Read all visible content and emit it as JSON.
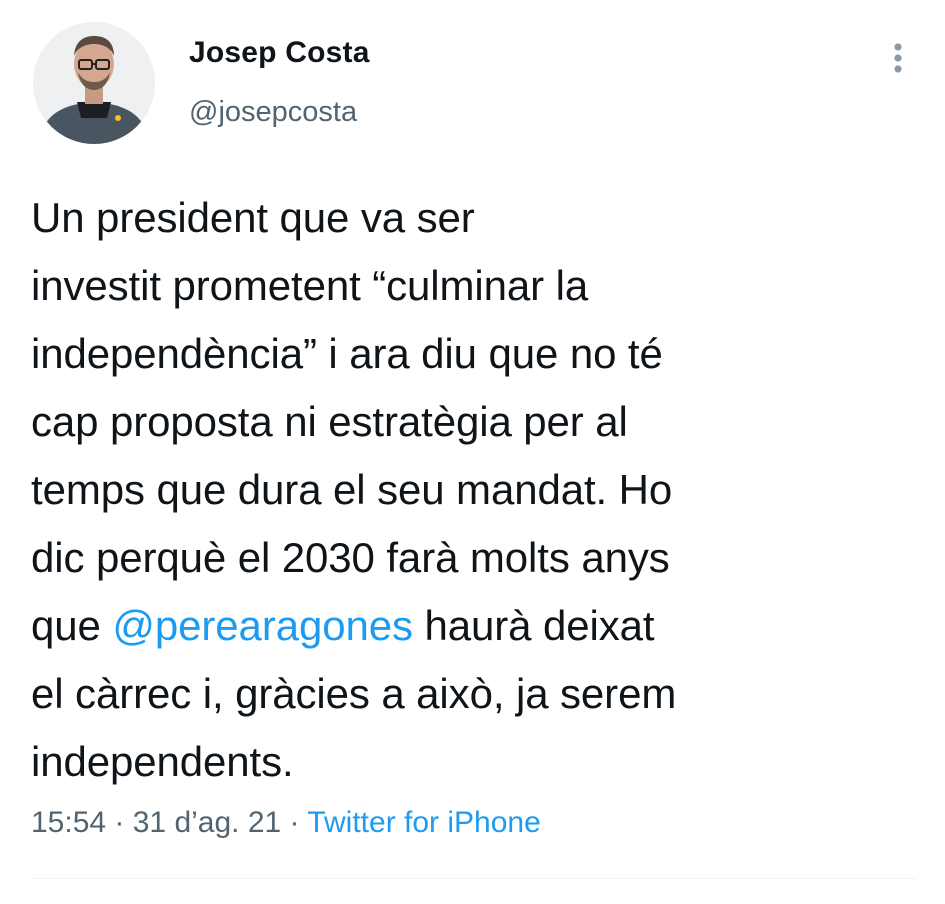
{
  "author": {
    "display_name": "Josep Costa",
    "handle": "@josepcosta"
  },
  "tweet": {
    "lines": [
      {
        "text": "Un president que va ser"
      },
      {
        "text": "investit prometent “culminar la"
      },
      {
        "text": "independència” i ara diu que no té"
      },
      {
        "text": "cap proposta ni estratègia per al"
      },
      {
        "text": "temps que dura el seu mandat. Ho"
      },
      {
        "text": "dic perquè el 2030 farà molts anys"
      },
      {
        "before": "que ",
        "mention": "@perearagones",
        "after": " haurà deixat"
      },
      {
        "text": "el càrrec i, gràcies a això, ja serem"
      },
      {
        "text": "independents."
      }
    ]
  },
  "meta": {
    "time": "15:54",
    "separator": " · ",
    "date": "31 d’ag. 21",
    "source": "Twitter for iPhone"
  },
  "icons": {
    "more": "more-vertical-icon"
  },
  "colors": {
    "link": "#1d9bf0",
    "secondary": "#536471",
    "text": "#0f1419"
  }
}
